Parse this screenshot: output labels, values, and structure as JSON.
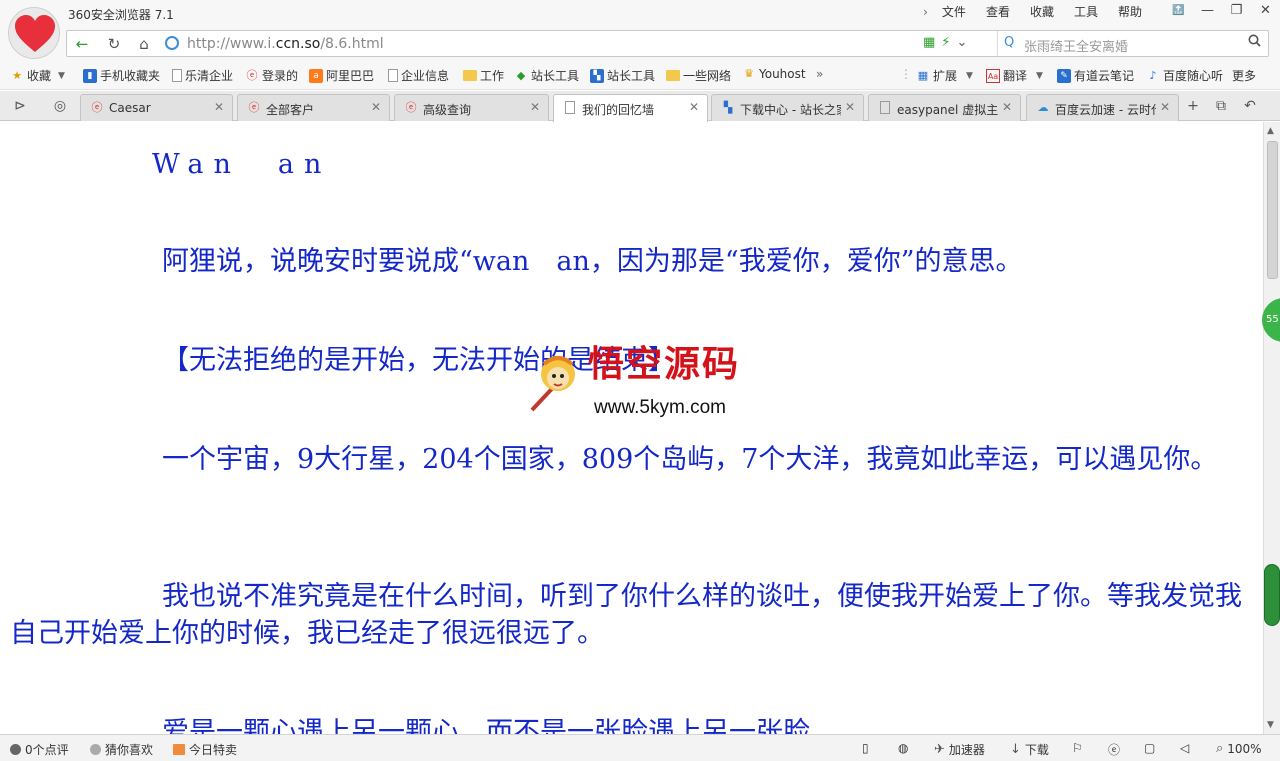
{
  "window": {
    "app_title": "360安全浏览器 7.1",
    "menu": [
      "文件",
      "查看",
      "收藏",
      "工具",
      "帮助"
    ],
    "controls": {
      "pin": "🔝",
      "minimize": "—",
      "restore": "❐",
      "close": "✕"
    }
  },
  "nav": {
    "back": "←",
    "reload": "↻",
    "home": "⌂",
    "url_prefix": "http://www.i.",
    "url_domain": "ccn.so",
    "url_path": "/8.6.html",
    "qr": "▦",
    "lightning": "⚡",
    "dropdown": "⌄",
    "search_placeholder": "张雨绮王全安离婚",
    "search_button": "🔍"
  },
  "bookmarks": {
    "favorites": "收藏",
    "items": [
      "手机收藏夹",
      "乐清企业",
      "登录的",
      "阿里巴巴",
      "企业信息",
      "工作",
      "站长工具",
      "站长工具",
      "一些网络",
      "Youhost"
    ],
    "more": "»",
    "right": [
      "扩展",
      "翻译",
      "有道云笔记",
      "百度随心听",
      "更多"
    ]
  },
  "tabs": [
    {
      "label": "Caesar",
      "active": false
    },
    {
      "label": "全部客户",
      "active": false
    },
    {
      "label": "高级查询",
      "active": false
    },
    {
      "label": "我们的回忆墙",
      "active": true
    },
    {
      "label": "下载中心 - 站长之家",
      "active": false
    },
    {
      "label": "easypanel 虚拟主机",
      "active": false
    },
    {
      "label": "百度云加速 - 云时代",
      "active": false
    }
  ],
  "tab_tools": {
    "new_tab": "+",
    "restore": "⧉",
    "undo": "↶"
  },
  "article": {
    "title": "Wan　an",
    "p1": "阿狸说，说晚安时要说成“wan　an，因为那是“我爱你，爱你”的意思。",
    "p2": "【无法拒绝的是开始，无法开始的是结束】",
    "p3": "一个宇宙，9大行星，204个国家，809个岛屿，7个大洋，我竟如此幸运，可以遇见你。",
    "p4": "我也说不准究竟是在什么时间，听到了你什么样的谈吐，便使我开始爱上了你。等我发觉我自己开始爱上你的时候，我已经走了很远很远了。",
    "p5": "爱是一颗心遇上另一颗心，而不是一张脸遇上另一张脸。"
  },
  "watermark": {
    "title": "悟空源码",
    "url": "www.5kym.com"
  },
  "side_badge": "55",
  "status": {
    "comments": "0个点评",
    "guess": "猜你喜欢",
    "deal": "今日特卖",
    "accelerator": "加速器",
    "download": "下载",
    "zoom": "100%"
  }
}
